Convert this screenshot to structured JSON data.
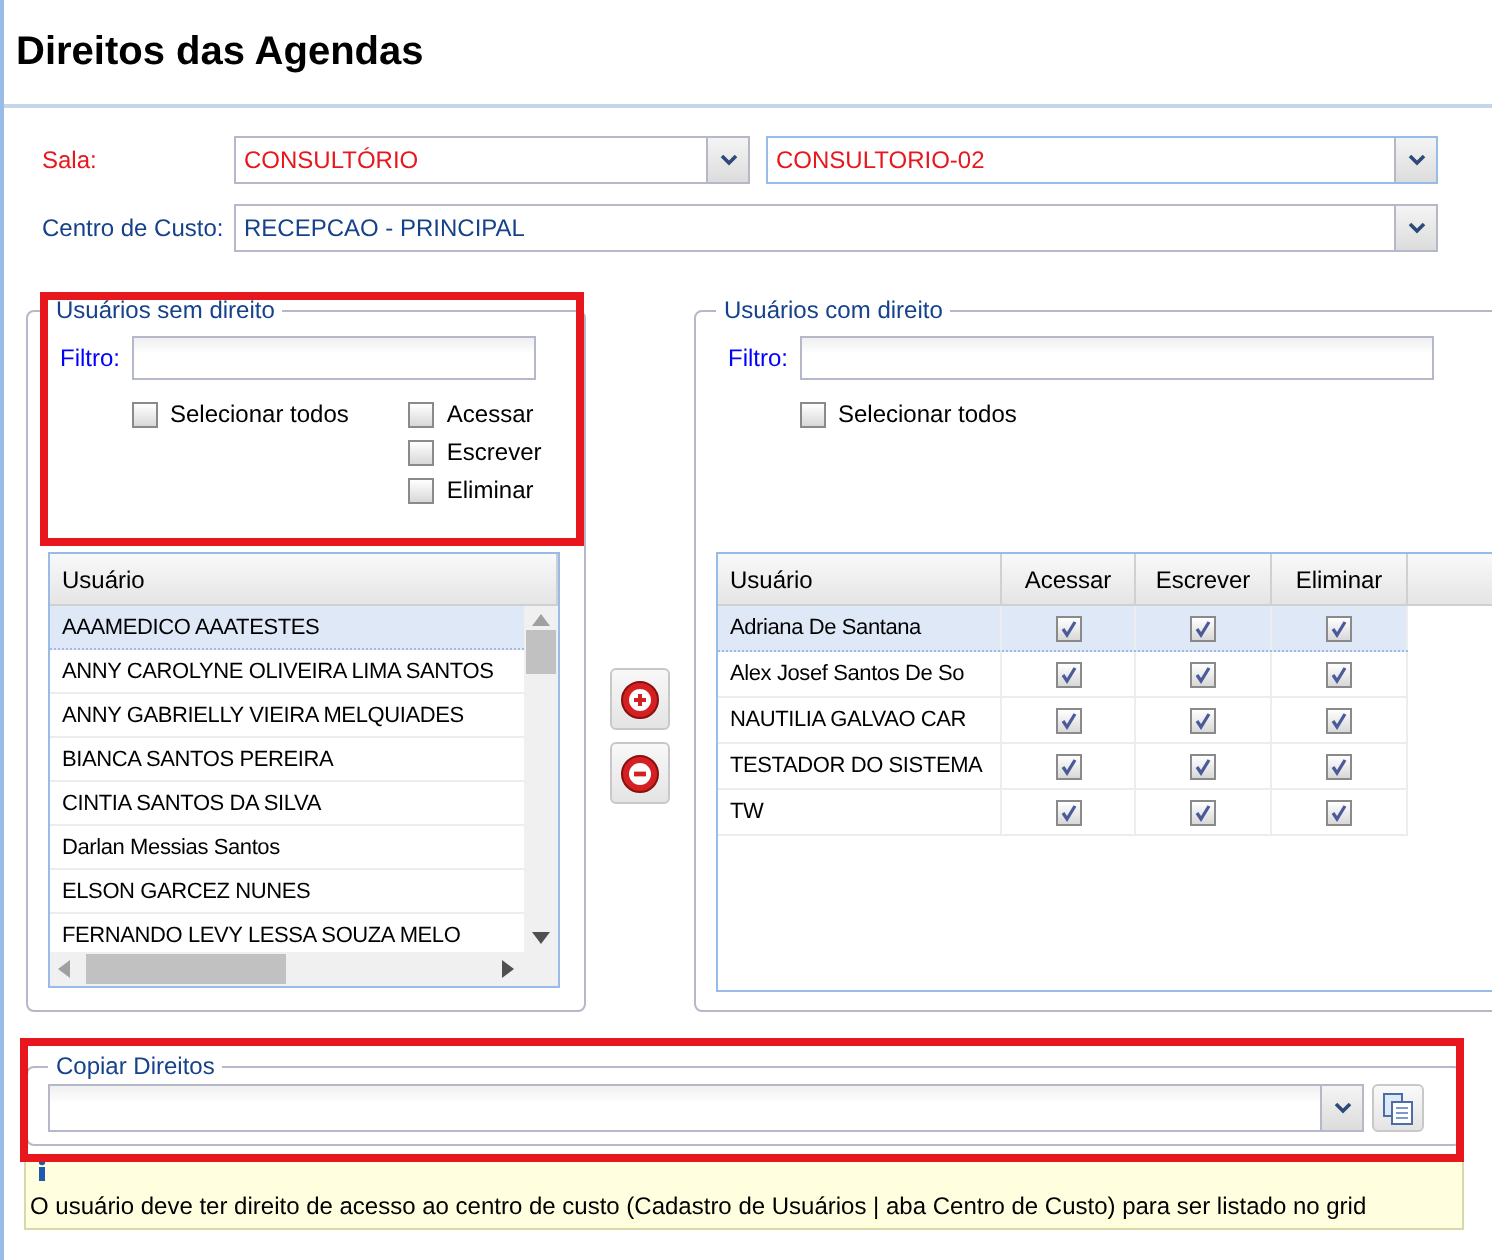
{
  "page": {
    "title": "Direitos das Agendas"
  },
  "sala": {
    "label": "Sala:",
    "room": "CONSULTÓRIO",
    "unit": "CONSULTORIO-02"
  },
  "centro": {
    "label": "Centro de Custo:",
    "value": "RECEPCAO - PRINCIPAL"
  },
  "sem_direito": {
    "legend": "Usuários sem direito",
    "filter_label": "Filtro:",
    "select_all": {
      "label": "Selecionar todos",
      "checked": false
    },
    "permissions": [
      {
        "label": "Acessar",
        "checked": false
      },
      {
        "label": "Escrever",
        "checked": false
      },
      {
        "label": "Eliminar",
        "checked": false
      }
    ],
    "column": "Usuário",
    "rows": [
      {
        "name": "AAAMEDICO AAATESTES",
        "selected": true
      },
      {
        "name": "ANNY CAROLYNE OLIVEIRA LIMA SANTOS",
        "selected": false
      },
      {
        "name": "ANNY GABRIELLY VIEIRA MELQUIADES",
        "selected": false
      },
      {
        "name": "BIANCA SANTOS PEREIRA",
        "selected": false
      },
      {
        "name": "CINTIA SANTOS DA SILVA",
        "selected": false
      },
      {
        "name": "Darlan Messias Santos",
        "selected": false
      },
      {
        "name": "ELSON GARCEZ NUNES",
        "selected": false
      },
      {
        "name": "FERNANDO LEVY LESSA SOUZA MELO",
        "selected": false
      }
    ]
  },
  "com_direito": {
    "legend": "Usuários com direito",
    "filter_label": "Filtro:",
    "select_all": {
      "label": "Selecionar todos",
      "checked": false
    },
    "columns": [
      "Usuário",
      "Acessar",
      "Escrever",
      "Eliminar"
    ],
    "rows": [
      {
        "name": "Adriana De Santana",
        "selected": true,
        "acessar": true,
        "escrever": true,
        "eliminar": true
      },
      {
        "name": "Alex Josef Santos De So",
        "selected": false,
        "acessar": true,
        "escrever": true,
        "eliminar": true
      },
      {
        "name": "NAUTILIA GALVAO CAR",
        "selected": false,
        "acessar": true,
        "escrever": true,
        "eliminar": true
      },
      {
        "name": "TESTADOR DO SISTEMA",
        "selected": false,
        "acessar": true,
        "escrever": true,
        "eliminar": true
      },
      {
        "name": "TW",
        "selected": false,
        "acessar": true,
        "escrever": true,
        "eliminar": true
      }
    ]
  },
  "copiar": {
    "legend": "Copiar Direitos"
  },
  "info": {
    "text": "O usuário deve ter direito de acesso ao centro de custo (Cadastro de Usuários | aba Centro de Custo) para ser listado no grid"
  }
}
